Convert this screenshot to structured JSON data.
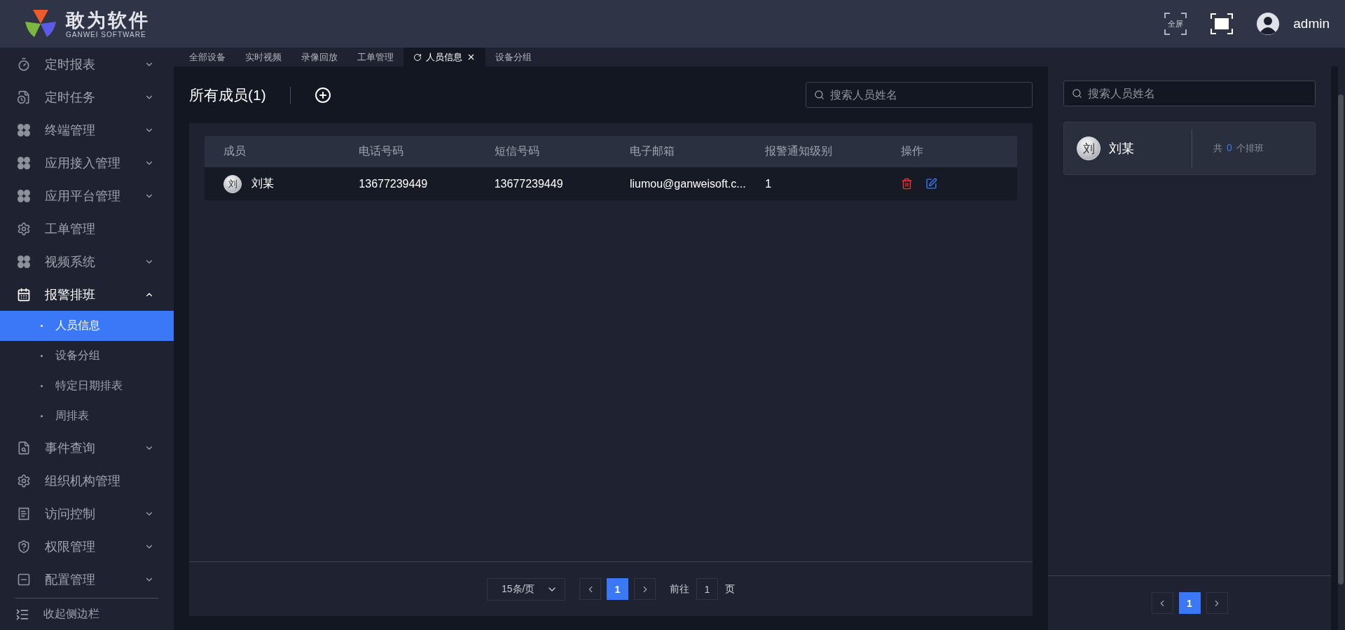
{
  "header": {
    "logo_title": "敢为软件",
    "logo_subtitle": "GANWEI SOFTWARE",
    "fullscreen_label": "全屏",
    "user": "admin"
  },
  "sidebar": {
    "items": [
      {
        "label": "定时报表",
        "kind": "timer",
        "expandable": true,
        "expanded": false
      },
      {
        "label": "定时任务",
        "kind": "file-clock",
        "expandable": true,
        "expanded": false
      },
      {
        "label": "终端管理",
        "kind": "clover",
        "expandable": true,
        "expanded": false
      },
      {
        "label": "应用接入管理",
        "kind": "clover",
        "expandable": true,
        "expanded": false
      },
      {
        "label": "应用平台管理",
        "kind": "clover",
        "expandable": true,
        "expanded": false
      },
      {
        "label": "工单管理",
        "kind": "gear",
        "expandable": false,
        "expanded": false
      },
      {
        "label": "视频系统",
        "kind": "clover",
        "expandable": true,
        "expanded": false
      },
      {
        "label": "报警排班",
        "kind": "calendar",
        "expandable": true,
        "expanded": true,
        "children": [
          {
            "label": "人员信息",
            "selected": true
          },
          {
            "label": "设备分组",
            "selected": false
          },
          {
            "label": "特定日期排表",
            "selected": false
          },
          {
            "label": "周排表",
            "selected": false
          }
        ]
      },
      {
        "label": "事件查询",
        "kind": "file-search",
        "expandable": true,
        "expanded": false
      },
      {
        "label": "组织机构管理",
        "kind": "gear",
        "expandable": false,
        "expanded": false
      },
      {
        "label": "访问控制",
        "kind": "receipt",
        "expandable": true,
        "expanded": false
      },
      {
        "label": "权限管理",
        "kind": "shield",
        "expandable": true,
        "expanded": false
      },
      {
        "label": "配置管理",
        "kind": "panel",
        "expandable": true,
        "expanded": false
      }
    ],
    "collapse_label": "收起侧边栏"
  },
  "tabs": [
    {
      "label": "全部设备",
      "selected": false
    },
    {
      "label": "实时视频",
      "selected": false
    },
    {
      "label": "录像回放",
      "selected": false
    },
    {
      "label": "工单管理",
      "selected": false
    },
    {
      "label": "人员信息",
      "selected": true
    },
    {
      "label": "设备分组",
      "selected": false
    }
  ],
  "members_panel": {
    "title": "所有成员(1)",
    "search": {
      "placeholder": "搜索人员姓名"
    },
    "table": {
      "columns": [
        "成员",
        "电话号码",
        "短信号码",
        "电子邮箱",
        "报警通知级别",
        "操作"
      ],
      "rows": [
        {
          "avatar": "刘",
          "name": "刘某",
          "phone": "13677239449",
          "sms": "13677239449",
          "email": "liumou@ganweisoft.c...",
          "alarm_level": "1"
        }
      ]
    },
    "pagination": {
      "page_size": "15条/页",
      "pages": [
        {
          "label": "1",
          "selected": true
        }
      ],
      "goto_label": "前往",
      "goto_value": "1",
      "page_unit": "页"
    }
  },
  "schedule_panel": {
    "search": {
      "placeholder": "搜索人员姓名"
    },
    "cards": [
      {
        "avatar": "刘",
        "name": "刘某",
        "count_prefix": "共",
        "count": "0",
        "count_suffix": "个排班"
      }
    ],
    "pagination": {
      "pages": [
        {
          "label": "1",
          "selected": true
        }
      ]
    }
  }
}
